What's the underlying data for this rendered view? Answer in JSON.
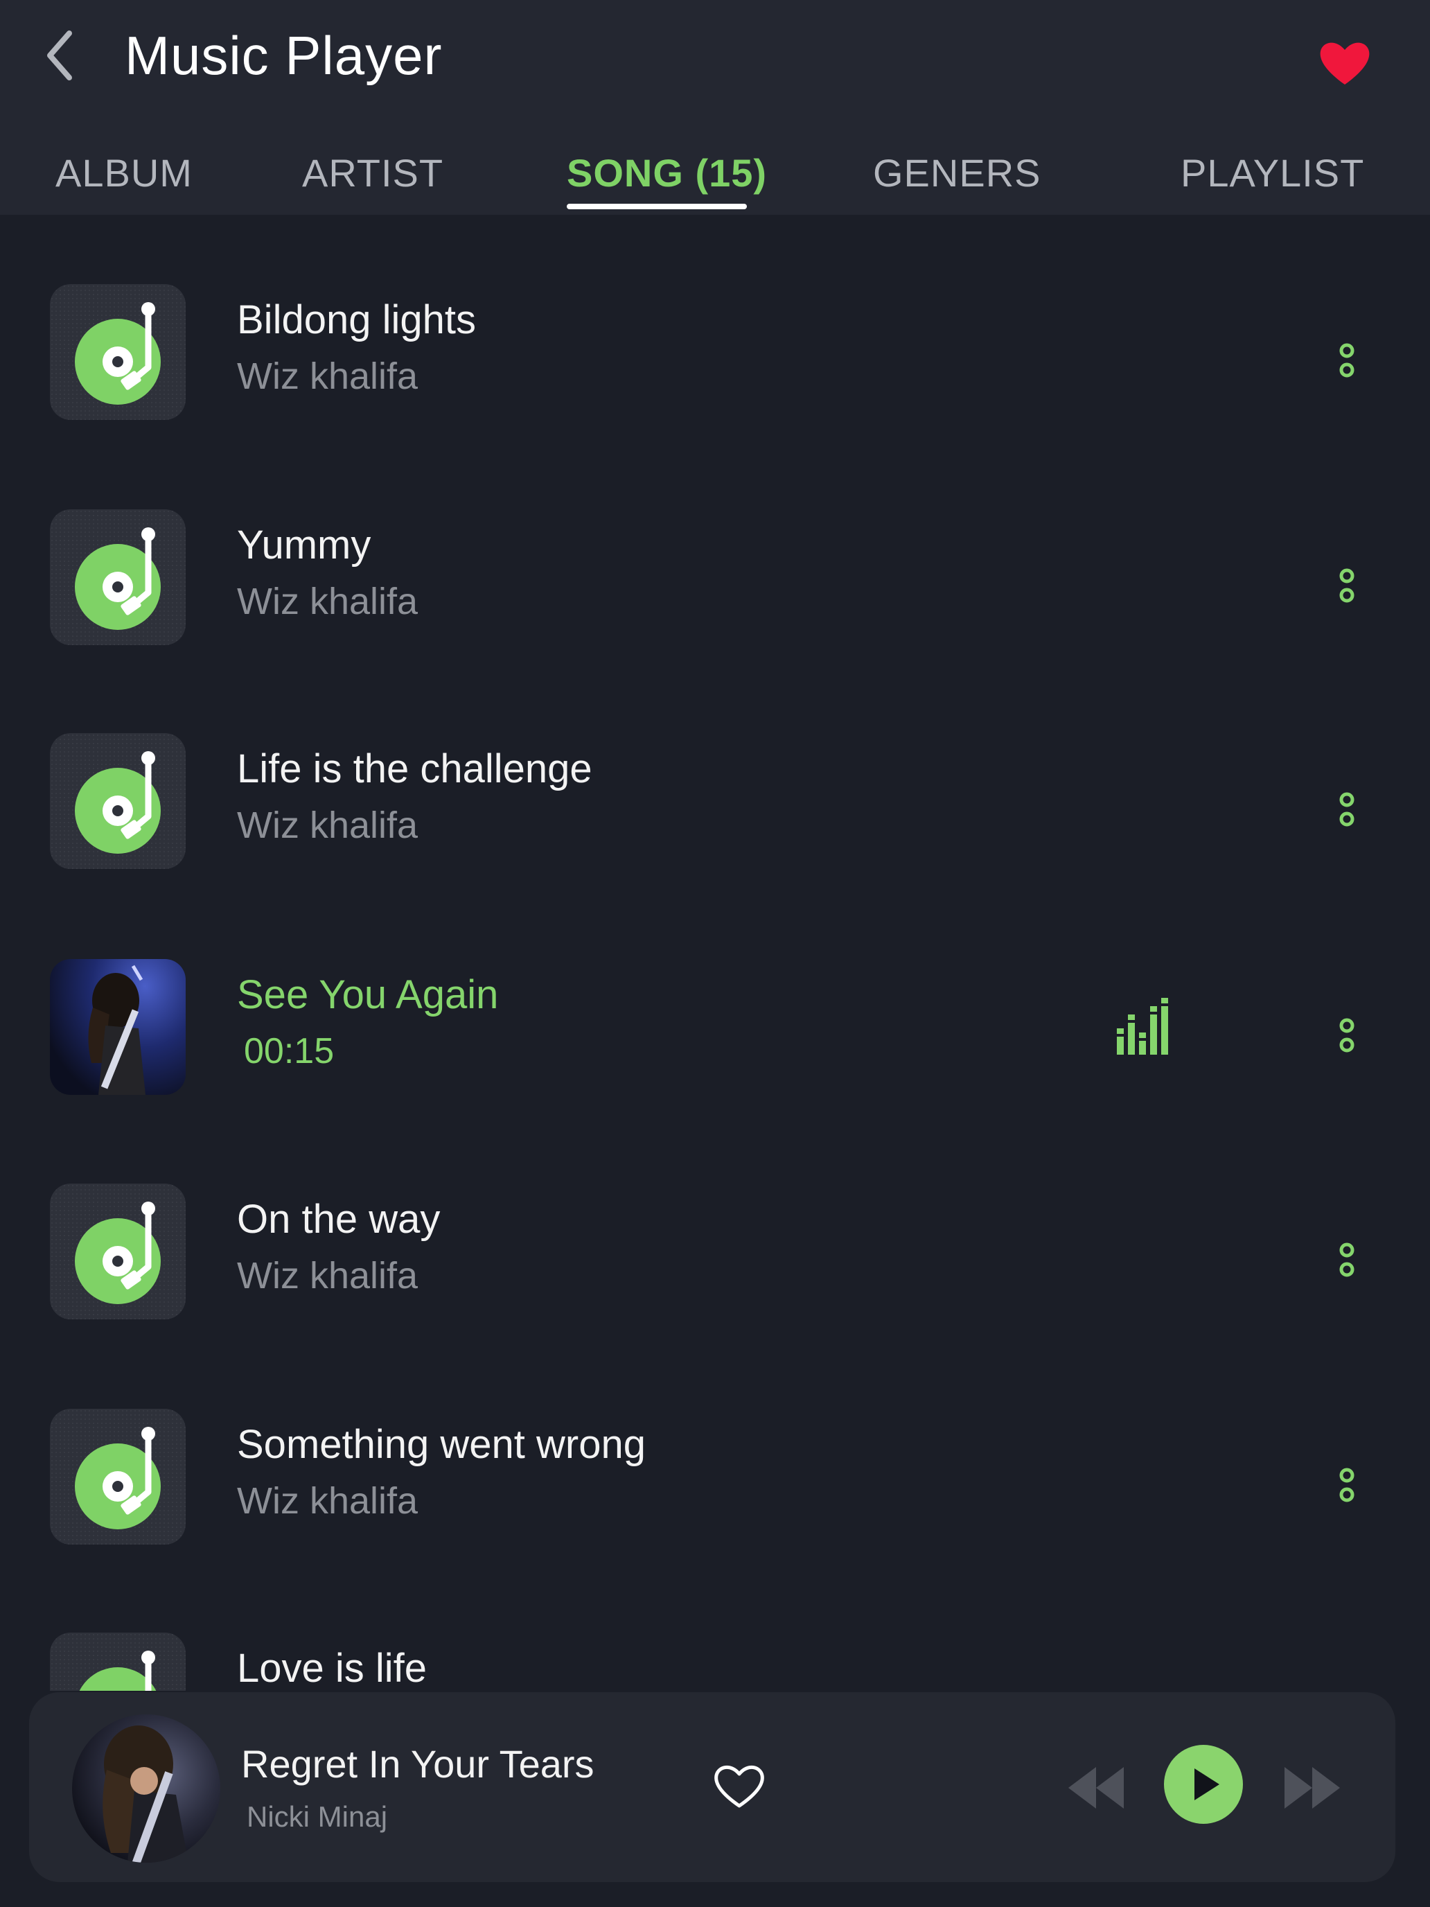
{
  "header": {
    "title": "Music Player",
    "back_icon": "chevron-left-icon",
    "favorite_icon": "heart-icon"
  },
  "tabs": [
    {
      "label": "ALBUM",
      "active": false
    },
    {
      "label": "ARTIST",
      "active": false
    },
    {
      "label": "SONG (15)",
      "active": true
    },
    {
      "label": "GENERS",
      "active": false
    },
    {
      "label": "PLAYLIST",
      "active": false
    }
  ],
  "songs": [
    {
      "title": "Bildong lights",
      "subtitle": "Wiz khalifa",
      "art": "vinyl-turntable-icon",
      "playing": false
    },
    {
      "title": "Yummy",
      "subtitle": "Wiz khalifa",
      "art": "vinyl-turntable-icon",
      "playing": false
    },
    {
      "title": "Life is the challenge",
      "subtitle": "Wiz khalifa",
      "art": "vinyl-turntable-icon",
      "playing": false
    },
    {
      "title": "See You Again",
      "subtitle": "00:15",
      "art": "guitarist-photo",
      "playing": true
    },
    {
      "title": "On the way",
      "subtitle": "Wiz khalifa",
      "art": "vinyl-turntable-icon",
      "playing": false
    },
    {
      "title": "Something went wrong",
      "subtitle": "Wiz khalifa",
      "art": "vinyl-turntable-icon",
      "playing": false
    },
    {
      "title": "Love is life",
      "subtitle": "",
      "art": "vinyl-turntable-icon",
      "playing": false
    }
  ],
  "now_playing": {
    "title": "Regret In Your Tears",
    "artist": "Nicki Minaj",
    "art": "guitarist-photo"
  },
  "colors": {
    "accent": "#85d56c",
    "background": "#1b1e27",
    "header": "#242731",
    "heart": "#f0173c",
    "muted_text": "#8d9097"
  }
}
